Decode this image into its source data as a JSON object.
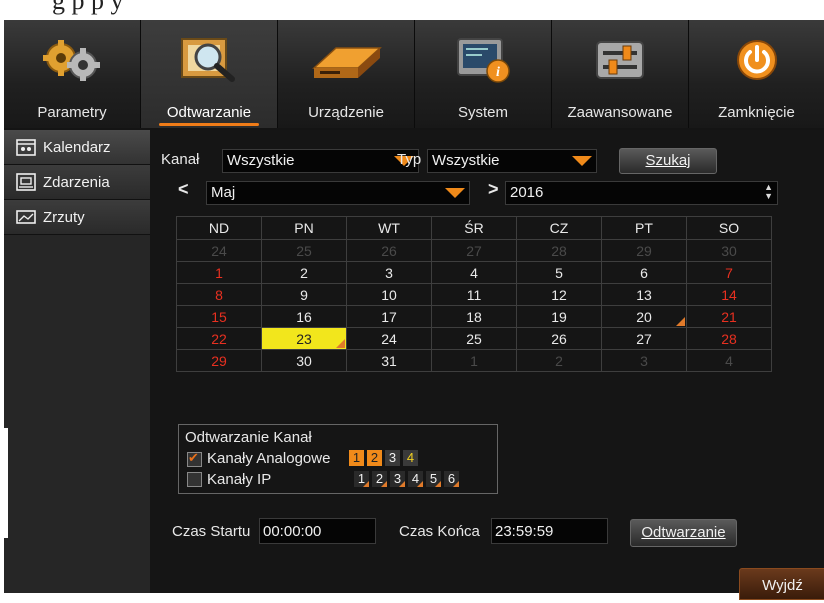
{
  "tabs": [
    {
      "label": "Parametry",
      "icon": "gears-icon"
    },
    {
      "label": "Odtwarzanie",
      "icon": "playback-magnifier-icon"
    },
    {
      "label": "Urządzenie",
      "icon": "hard-drive-icon"
    },
    {
      "label": "System",
      "icon": "system-info-icon"
    },
    {
      "label": "Zaawansowane",
      "icon": "sliders-icon"
    },
    {
      "label": "Zamknięcie",
      "icon": "power-icon"
    }
  ],
  "active_tab": "Odtwarzanie",
  "sidebar": [
    {
      "label": "Kalendarz",
      "icon": "calendar-icon"
    },
    {
      "label": "Zdarzenia",
      "icon": "events-icon"
    },
    {
      "label": "Zrzuty",
      "icon": "snapshot-icon"
    }
  ],
  "filters": {
    "channel_label": "Kanał",
    "channel_value": "Wszystkie",
    "type_label": "Typ",
    "type_value": "Wszystkie",
    "search_button": "Szukaj"
  },
  "month_nav": {
    "prev": "<",
    "month": "Maj",
    "next": ">",
    "year": "2016"
  },
  "calendar": {
    "weekdays": [
      "ND",
      "PN",
      "WT",
      "ŚR",
      "CZ",
      "PT",
      "SO"
    ],
    "weeks": [
      [
        "24",
        "25",
        "26",
        "27",
        "28",
        "29",
        "30"
      ],
      [
        "1",
        "2",
        "3",
        "4",
        "5",
        "6",
        "7"
      ],
      [
        "8",
        "9",
        "10",
        "11",
        "12",
        "13",
        "14"
      ],
      [
        "15",
        "16",
        "17",
        "18",
        "19",
        "20",
        "21"
      ],
      [
        "22",
        "23",
        "24",
        "25",
        "26",
        "27",
        "28"
      ],
      [
        "29",
        "30",
        "31",
        "1",
        "2",
        "3",
        "4"
      ]
    ],
    "selected_day": "23",
    "days_with_recordings": [
      "20",
      "23"
    ]
  },
  "playback_channels": {
    "title": "Odtwarzanie Kanał",
    "analog_label": "Kanały Analogowe",
    "analog_checked": true,
    "analog_channels": [
      "1",
      "2",
      "3",
      "4"
    ],
    "ip_label": "Kanały IP",
    "ip_checked": false,
    "ip_channels": [
      "1",
      "2",
      "3",
      "4",
      "5",
      "6"
    ]
  },
  "time": {
    "start_label": "Czas Startu",
    "start_value": "00:00:00",
    "end_label": "Czas Końca",
    "end_value": "23:59:59",
    "play_button": "Odtwarzanie"
  },
  "exit_button": "Wyjdź",
  "colors": {
    "accent": "#f08a1a",
    "weekend": "#e83020",
    "selected": "#f2e61c",
    "background": "#151515"
  }
}
